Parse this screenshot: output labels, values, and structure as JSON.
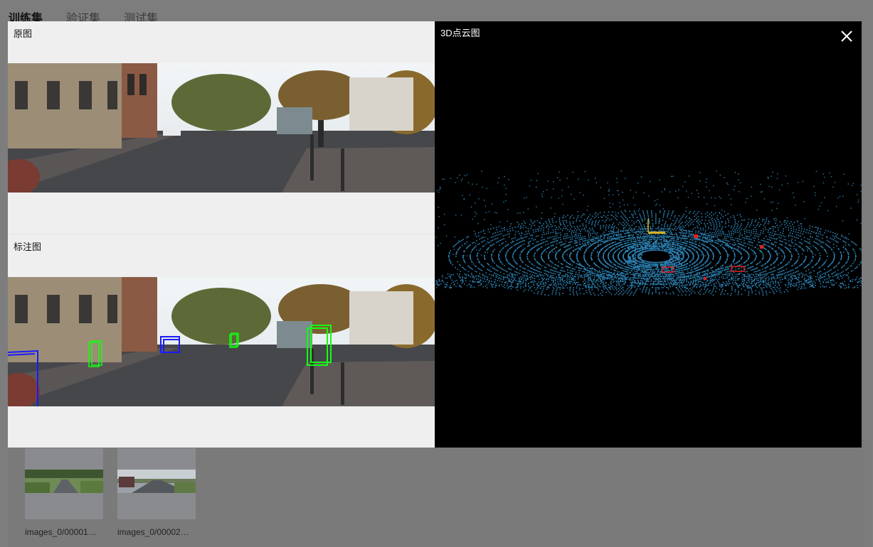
{
  "tabs": [
    {
      "label": "训练集",
      "active": true
    },
    {
      "label": "验证集",
      "active": false
    },
    {
      "label": "测试集",
      "active": false
    }
  ],
  "thumbnails": [
    {
      "label": "images_0/00001…",
      "icon": "road-forest-thumbnail"
    },
    {
      "label": "images_0/00002…",
      "icon": "road-truck-thumbnail"
    }
  ],
  "modal": {
    "original_title": "原图",
    "annotated_title": "标注图",
    "pointcloud_title": "3D点云图",
    "close_icon": "close-icon"
  },
  "colors": {
    "overlay_bg": "#7d7d7d",
    "panel_bg": "#efefef",
    "pointcloud_bg": "#000000",
    "point_color": "#2a7fb0",
    "box_car": "#1a1aff",
    "box_pedestrian": "#12ff12",
    "box_pc_object": "#e02020",
    "box_pc_ego": "#e0c020"
  }
}
